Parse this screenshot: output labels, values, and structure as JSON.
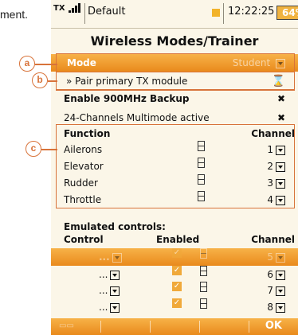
{
  "intro_text": "ment.",
  "status": {
    "tx_label": "TX",
    "model_name": "Default",
    "time": "12:22:25",
    "battery": "64%"
  },
  "title": "Wireless Modes/Trainer",
  "mode_row": {
    "label": "Mode",
    "value": "Student"
  },
  "pair_row": {
    "label": "» Pair primary TX module",
    "icon": "hourglass-icon",
    "symbol": "⌛"
  },
  "backup_row": {
    "label": "Enable 900MHz Backup",
    "symbol": "✖"
  },
  "multimode_row": {
    "label": "24-Channels Multimode active",
    "symbol": "✖"
  },
  "functions": {
    "header_function": "Function",
    "header_channel": "Channel",
    "rows": [
      {
        "name": "Ailerons",
        "channel": "1"
      },
      {
        "name": "Elevator",
        "channel": "2"
      },
      {
        "name": "Rudder",
        "channel": "3"
      },
      {
        "name": "Throttle",
        "channel": "4"
      }
    ]
  },
  "emulated": {
    "title": "Emulated controls:",
    "header_control": "Control",
    "header_enabled": "Enabled",
    "header_channel": "Channel",
    "rows": [
      {
        "control": "...",
        "channel": "5"
      },
      {
        "control": "...",
        "channel": "6"
      },
      {
        "control": "...",
        "channel": "7"
      },
      {
        "control": "...",
        "channel": "8"
      }
    ]
  },
  "footer": {
    "ok_label": "OK"
  },
  "callouts": {
    "a": "a",
    "b": "b",
    "c": "c"
  },
  "colors": {
    "accent": "#e98a1c",
    "callout": "#d8733a",
    "background": "#fbf6e8"
  }
}
